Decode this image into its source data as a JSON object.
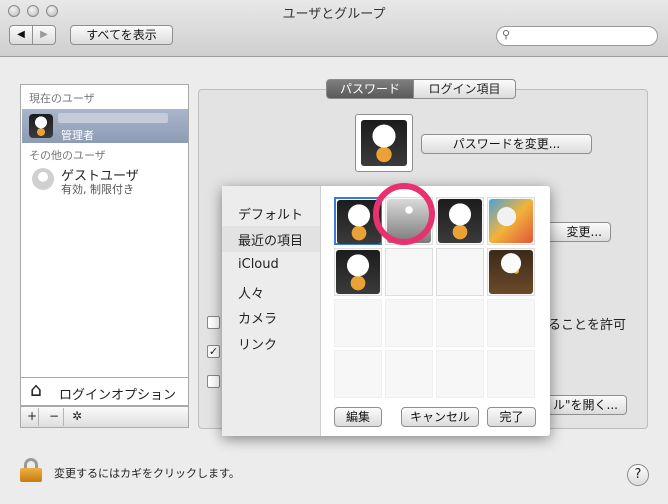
{
  "window": {
    "title": "ユーザとグループ"
  },
  "toolbar": {
    "back": "◀",
    "forward": "▶",
    "show_all": "すべてを表示",
    "search_placeholder": ""
  },
  "sidebar": {
    "current_users_header": "現在のユーザ",
    "current_user_role": "管理者",
    "other_users_header": "その他のユーザ",
    "guest_name": "ゲストユーザ",
    "guest_status": "有効, 制限付き",
    "login_options": "ログインオプション",
    "add": "+",
    "remove": "−",
    "gear": "✲"
  },
  "tabs": {
    "password": "パスワード",
    "login_items": "ログイン項目"
  },
  "main": {
    "change_password": "パスワードを変更...",
    "change_partial": "変更...",
    "allow_partial": "ることを許可",
    "open_partial": "ル\"を開く..."
  },
  "popover": {
    "categories": [
      "デフォルト",
      "最近の項目",
      "iCloud",
      "人々",
      "カメラ",
      "リンク"
    ],
    "edit": "編集",
    "cancel": "キャンセル",
    "done": "完了"
  },
  "footer": {
    "lock_text": "変更するにはカギをクリックします。",
    "help": "?"
  },
  "colors": {
    "highlight_ring": "#e8326f",
    "selection": "#8d9bb4"
  }
}
